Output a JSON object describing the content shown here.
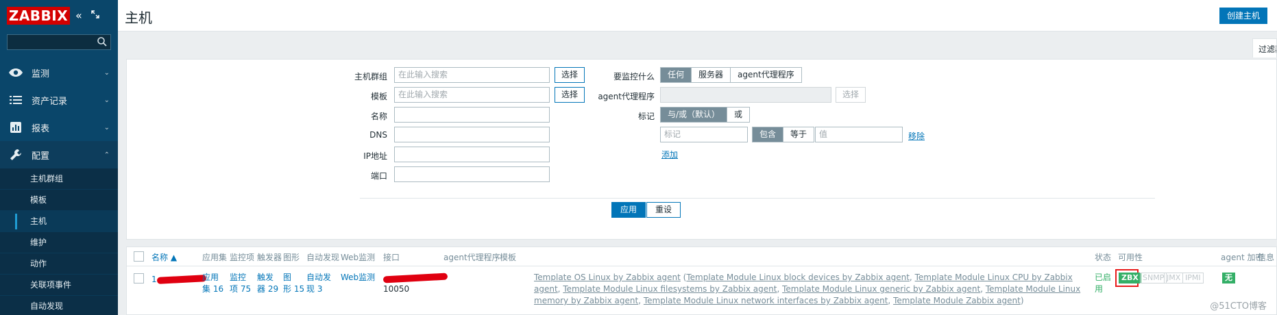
{
  "app": {
    "logo": "ZABBIX"
  },
  "sidebar": {
    "search_placeholder": "",
    "menu": [
      {
        "label": "监测",
        "icon": "eye-icon"
      },
      {
        "label": "资产记录",
        "icon": "list-icon"
      },
      {
        "label": "报表",
        "icon": "bar-chart-icon"
      },
      {
        "label": "配置",
        "icon": "wrench-icon"
      }
    ],
    "submenu": [
      "主机群组",
      "模板",
      "主机",
      "维护",
      "动作",
      "关联项事件",
      "自动发现"
    ]
  },
  "header": {
    "title": "主机",
    "create_button": "创建主机"
  },
  "filter_tab": "过滤器",
  "filter": {
    "host_group_label": "主机群组",
    "host_group_placeholder": "在此输入搜索",
    "template_label": "模板",
    "template_placeholder": "在此输入搜索",
    "select_label": "选择",
    "name_label": "名称",
    "dns_label": "DNS",
    "ip_label": "IP地址",
    "port_label": "端口",
    "monitor_label": "要监控什么",
    "monitor_options": [
      "任何",
      "服务器",
      "agent代理程序"
    ],
    "proxy_label": "agent代理程序",
    "tags_label": "标记",
    "tag_logic_options": [
      "与/或（默认）",
      "或"
    ],
    "tag_placeholder": "标记",
    "tag_op_options": [
      "包含",
      "等于"
    ],
    "value_placeholder": "值",
    "remove_link": "移除",
    "add_link": "添加",
    "apply": "应用",
    "reset": "重设"
  },
  "table": {
    "columns": [
      "名称 ▲",
      "应用集",
      "监控项",
      "触发器",
      "图形",
      "自动发现",
      "Web监测",
      "接口",
      "agent代理程序",
      "模板",
      "状态",
      "可用性",
      "agent 加密",
      "信息"
    ],
    "row": {
      "name_prefix": "1",
      "apps": [
        "应用",
        "集 16"
      ],
      "items": [
        "监控",
        "项 75"
      ],
      "triggers": [
        "触发",
        "器 29"
      ],
      "graphs": [
        "图",
        "形 15"
      ],
      "discovery": [
        "自动发",
        "现 3"
      ],
      "web": "Web监测",
      "interface_port": "10050",
      "templates": [
        "Template OS Linux by Zabbix agent",
        "Template Module Linux block devices by Zabbix agent",
        "Template Module Linux CPU by Zabbix agent",
        "Template Module Linux filesystems by Zabbix agent",
        "Template Module Linux generic by Zabbix agent",
        "Template Module Linux memory by Zabbix agent",
        "Template Module Linux network interfaces by Zabbix agent",
        "Template Module Zabbix agent"
      ],
      "status": [
        "已启",
        "用"
      ],
      "availability": [
        "ZBX",
        "SNMP",
        "JMX",
        "IPMI"
      ],
      "encryption": "无"
    }
  },
  "watermark": "@51CTO博客",
  "colors": {
    "sidebar": "#0a466a",
    "primary": "#0275b8",
    "zbx_green": "#34af67",
    "logo_red": "#d40000"
  }
}
